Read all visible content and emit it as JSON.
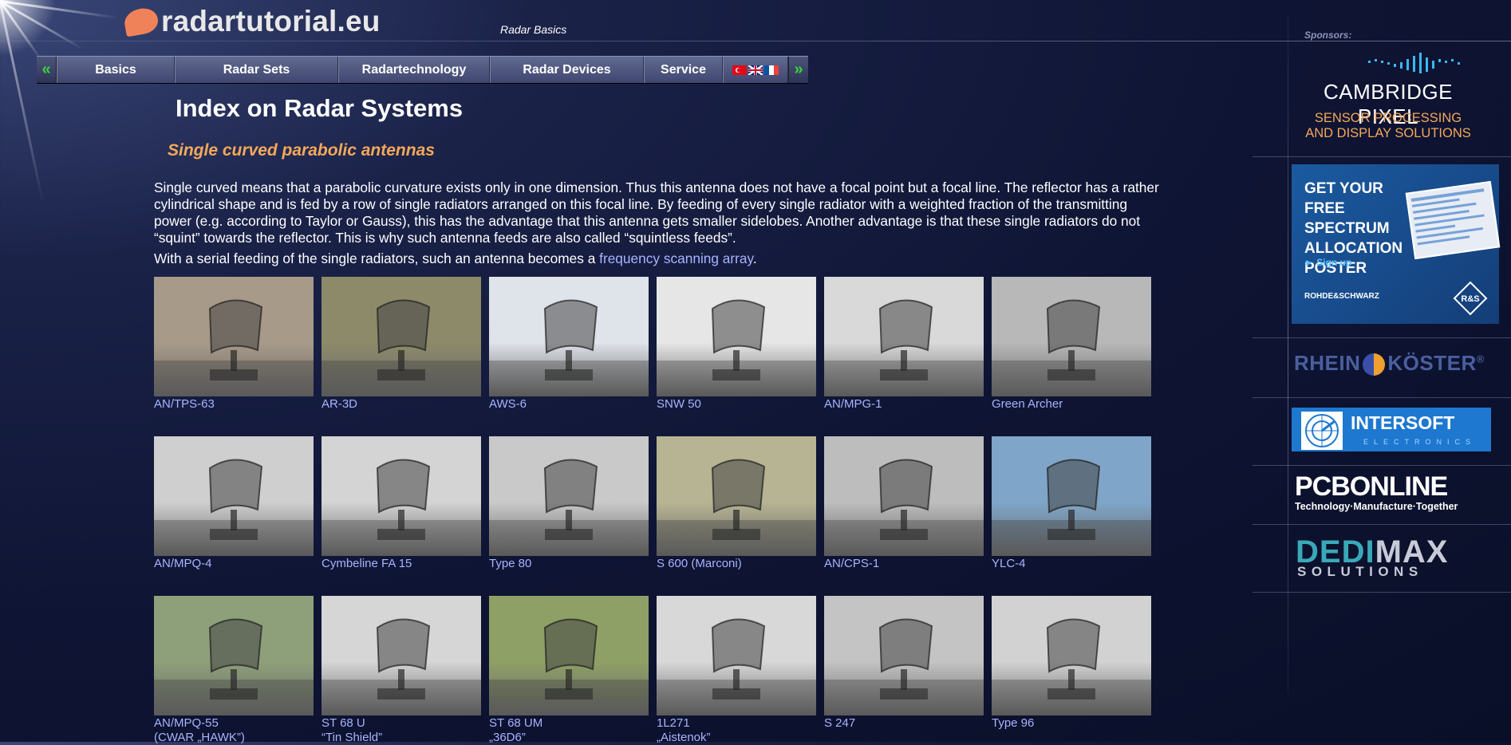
{
  "header": {
    "logo_text": "radartutorial.eu",
    "breadcrumb": "Radar Basics"
  },
  "nav": {
    "prev_arrow": "«",
    "next_arrow": "»",
    "items": [
      {
        "label": "Basics"
      },
      {
        "label": "Radar Sets"
      },
      {
        "label": "Radartechnology"
      },
      {
        "label": "Radar Devices"
      },
      {
        "label": "Service"
      }
    ]
  },
  "main": {
    "page_title": "Index on Radar Systems",
    "subtitle": "Single curved parabolic antennas",
    "paragraph1": "Single curved means that a parabolic curvature exists only in one dimension. Thus this antenna does not have a focal point but a focal line. The reflector has a rather cylindrical shape and is fed by a row of single radiators arranged on this focal line. By feeding of every single radiator with a weighted fraction of the transmitting power (e.g. according to Taylor or Gauss), this has the advantage that this antenna gets smaller sidelobes. Another advantage is that these single radiators do not “squint” towards the reflector. This is why such antenna feeds are also called “squintless feeds”.",
    "paragraph2_before": "With a serial feeding of the single radiators, such an antenna becomes a ",
    "paragraph2_link": "frequency scanning array",
    "paragraph2_after": ".",
    "radars": [
      {
        "line1": "AN/TPS-63",
        "line2": "",
        "tone": "#a89a88"
      },
      {
        "line1": "AR-3D",
        "line2": "",
        "tone": "#8d8a6a"
      },
      {
        "line1": "AWS-6",
        "line2": "",
        "tone": "#dfe3ea"
      },
      {
        "line1": "SNW 50",
        "line2": "",
        "tone": "#e6e6e6"
      },
      {
        "line1": "AN/MPG-1",
        "line2": "",
        "tone": "#d9d9d9"
      },
      {
        "line1": "Green Archer",
        "line2": "",
        "tone": "#b8b8b8"
      },
      {
        "line1": "AN/MPQ-4",
        "line2": "",
        "tone": "#cfcfcf"
      },
      {
        "line1": "Cymbeline FA 15",
        "line2": "",
        "tone": "#d4d4d4"
      },
      {
        "line1": "Type 80",
        "line2": "",
        "tone": "#c9c9c9"
      },
      {
        "line1": "S 600 (Marconi)",
        "line2": "",
        "tone": "#b7b493"
      },
      {
        "line1": "AN/CPS-1",
        "line2": "",
        "tone": "#bdbdbd"
      },
      {
        "line1": "YLC-4",
        "line2": "",
        "tone": "#7fa6c8"
      },
      {
        "line1": "AN/MPQ-55",
        "line2": "(CWAR „HAWK”)",
        "tone": "#8ea07a"
      },
      {
        "line1": "ST 68 U",
        "line2": "“Tin Shield”",
        "tone": "#d6d6d6"
      },
      {
        "line1": "ST 68 UM",
        "line2": "„36D6”",
        "tone": "#8fa066"
      },
      {
        "line1": "1L271",
        "line2": "„Aistenok”",
        "tone": "#d8d8d8"
      },
      {
        "line1": "S 247",
        "line2": "",
        "tone": "#c4c4c4"
      },
      {
        "line1": "Type 96",
        "line2": "",
        "tone": "#d2d2d2"
      }
    ]
  },
  "sidebar": {
    "label": "Sponsors:",
    "cambridge_title": "CAMBRIDGE PIXEL",
    "cambridge_line1": "SENSOR PROCESSING",
    "cambridge_line2": "AND DISPLAY SOLUTIONS",
    "rs_title": "GET YOUR FREE SPECTRUM ALLOCATION POSTER",
    "rs_sign_up": "► Sign up",
    "rs_brand": "ROHDE&SCHWARZ",
    "rk_before": "RHEIN",
    "rk_after": "KÖSTER",
    "rk_reg": "®",
    "intersoft_title": "INTERSOFT",
    "intersoft_sub": "ELECTRONICS",
    "pcb_title": "PCBONLINE",
    "pcb_sub": "Technology·Manufacture·Together",
    "dedimax_part1": "DEDI",
    "dedimax_part2": "MAX",
    "dedimax_sub": "SOLUTIONS"
  },
  "colors": {
    "accent_orange": "#f5a85a",
    "link_blue": "#a8b4ff",
    "nav_arrow_green": "#39d639",
    "dedimax_teal": "#3aa8b8",
    "dedimax_grey": "#c8cad8"
  }
}
